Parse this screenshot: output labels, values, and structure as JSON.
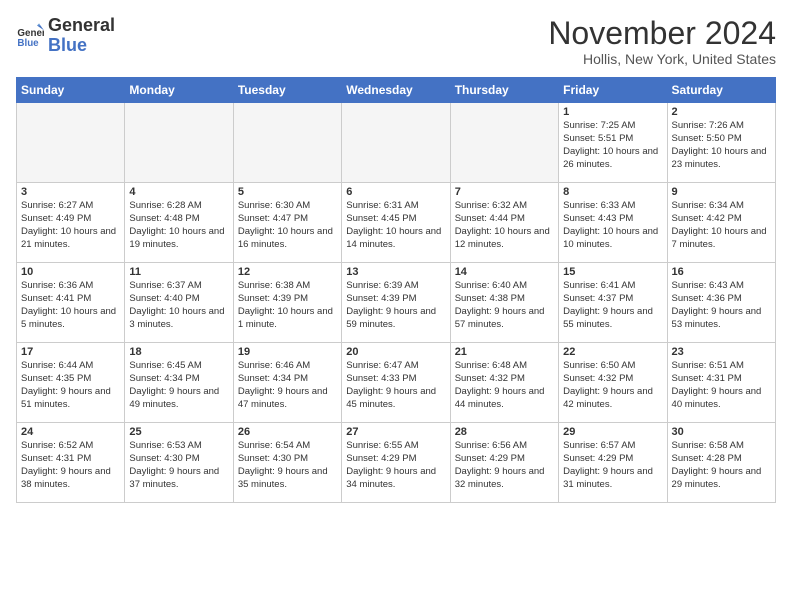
{
  "logo": {
    "line1": "General",
    "line2": "Blue"
  },
  "title": "November 2024",
  "location": "Hollis, New York, United States",
  "weekdays": [
    "Sunday",
    "Monday",
    "Tuesday",
    "Wednesday",
    "Thursday",
    "Friday",
    "Saturday"
  ],
  "weeks": [
    [
      {
        "day": "",
        "info": ""
      },
      {
        "day": "",
        "info": ""
      },
      {
        "day": "",
        "info": ""
      },
      {
        "day": "",
        "info": ""
      },
      {
        "day": "",
        "info": ""
      },
      {
        "day": "1",
        "info": "Sunrise: 7:25 AM\nSunset: 5:51 PM\nDaylight: 10 hours\nand 26 minutes."
      },
      {
        "day": "2",
        "info": "Sunrise: 7:26 AM\nSunset: 5:50 PM\nDaylight: 10 hours\nand 23 minutes."
      }
    ],
    [
      {
        "day": "3",
        "info": "Sunrise: 6:27 AM\nSunset: 4:49 PM\nDaylight: 10 hours\nand 21 minutes."
      },
      {
        "day": "4",
        "info": "Sunrise: 6:28 AM\nSunset: 4:48 PM\nDaylight: 10 hours\nand 19 minutes."
      },
      {
        "day": "5",
        "info": "Sunrise: 6:30 AM\nSunset: 4:47 PM\nDaylight: 10 hours\nand 16 minutes."
      },
      {
        "day": "6",
        "info": "Sunrise: 6:31 AM\nSunset: 4:45 PM\nDaylight: 10 hours\nand 14 minutes."
      },
      {
        "day": "7",
        "info": "Sunrise: 6:32 AM\nSunset: 4:44 PM\nDaylight: 10 hours\nand 12 minutes."
      },
      {
        "day": "8",
        "info": "Sunrise: 6:33 AM\nSunset: 4:43 PM\nDaylight: 10 hours\nand 10 minutes."
      },
      {
        "day": "9",
        "info": "Sunrise: 6:34 AM\nSunset: 4:42 PM\nDaylight: 10 hours\nand 7 minutes."
      }
    ],
    [
      {
        "day": "10",
        "info": "Sunrise: 6:36 AM\nSunset: 4:41 PM\nDaylight: 10 hours\nand 5 minutes."
      },
      {
        "day": "11",
        "info": "Sunrise: 6:37 AM\nSunset: 4:40 PM\nDaylight: 10 hours\nand 3 minutes."
      },
      {
        "day": "12",
        "info": "Sunrise: 6:38 AM\nSunset: 4:39 PM\nDaylight: 10 hours\nand 1 minute."
      },
      {
        "day": "13",
        "info": "Sunrise: 6:39 AM\nSunset: 4:39 PM\nDaylight: 9 hours\nand 59 minutes."
      },
      {
        "day": "14",
        "info": "Sunrise: 6:40 AM\nSunset: 4:38 PM\nDaylight: 9 hours\nand 57 minutes."
      },
      {
        "day": "15",
        "info": "Sunrise: 6:41 AM\nSunset: 4:37 PM\nDaylight: 9 hours\nand 55 minutes."
      },
      {
        "day": "16",
        "info": "Sunrise: 6:43 AM\nSunset: 4:36 PM\nDaylight: 9 hours\nand 53 minutes."
      }
    ],
    [
      {
        "day": "17",
        "info": "Sunrise: 6:44 AM\nSunset: 4:35 PM\nDaylight: 9 hours\nand 51 minutes."
      },
      {
        "day": "18",
        "info": "Sunrise: 6:45 AM\nSunset: 4:34 PM\nDaylight: 9 hours\nand 49 minutes."
      },
      {
        "day": "19",
        "info": "Sunrise: 6:46 AM\nSunset: 4:34 PM\nDaylight: 9 hours\nand 47 minutes."
      },
      {
        "day": "20",
        "info": "Sunrise: 6:47 AM\nSunset: 4:33 PM\nDaylight: 9 hours\nand 45 minutes."
      },
      {
        "day": "21",
        "info": "Sunrise: 6:48 AM\nSunset: 4:32 PM\nDaylight: 9 hours\nand 44 minutes."
      },
      {
        "day": "22",
        "info": "Sunrise: 6:50 AM\nSunset: 4:32 PM\nDaylight: 9 hours\nand 42 minutes."
      },
      {
        "day": "23",
        "info": "Sunrise: 6:51 AM\nSunset: 4:31 PM\nDaylight: 9 hours\nand 40 minutes."
      }
    ],
    [
      {
        "day": "24",
        "info": "Sunrise: 6:52 AM\nSunset: 4:31 PM\nDaylight: 9 hours\nand 38 minutes."
      },
      {
        "day": "25",
        "info": "Sunrise: 6:53 AM\nSunset: 4:30 PM\nDaylight: 9 hours\nand 37 minutes."
      },
      {
        "day": "26",
        "info": "Sunrise: 6:54 AM\nSunset: 4:30 PM\nDaylight: 9 hours\nand 35 minutes."
      },
      {
        "day": "27",
        "info": "Sunrise: 6:55 AM\nSunset: 4:29 PM\nDaylight: 9 hours\nand 34 minutes."
      },
      {
        "day": "28",
        "info": "Sunrise: 6:56 AM\nSunset: 4:29 PM\nDaylight: 9 hours\nand 32 minutes."
      },
      {
        "day": "29",
        "info": "Sunrise: 6:57 AM\nSunset: 4:29 PM\nDaylight: 9 hours\nand 31 minutes."
      },
      {
        "day": "30",
        "info": "Sunrise: 6:58 AM\nSunset: 4:28 PM\nDaylight: 9 hours\nand 29 minutes."
      }
    ]
  ]
}
